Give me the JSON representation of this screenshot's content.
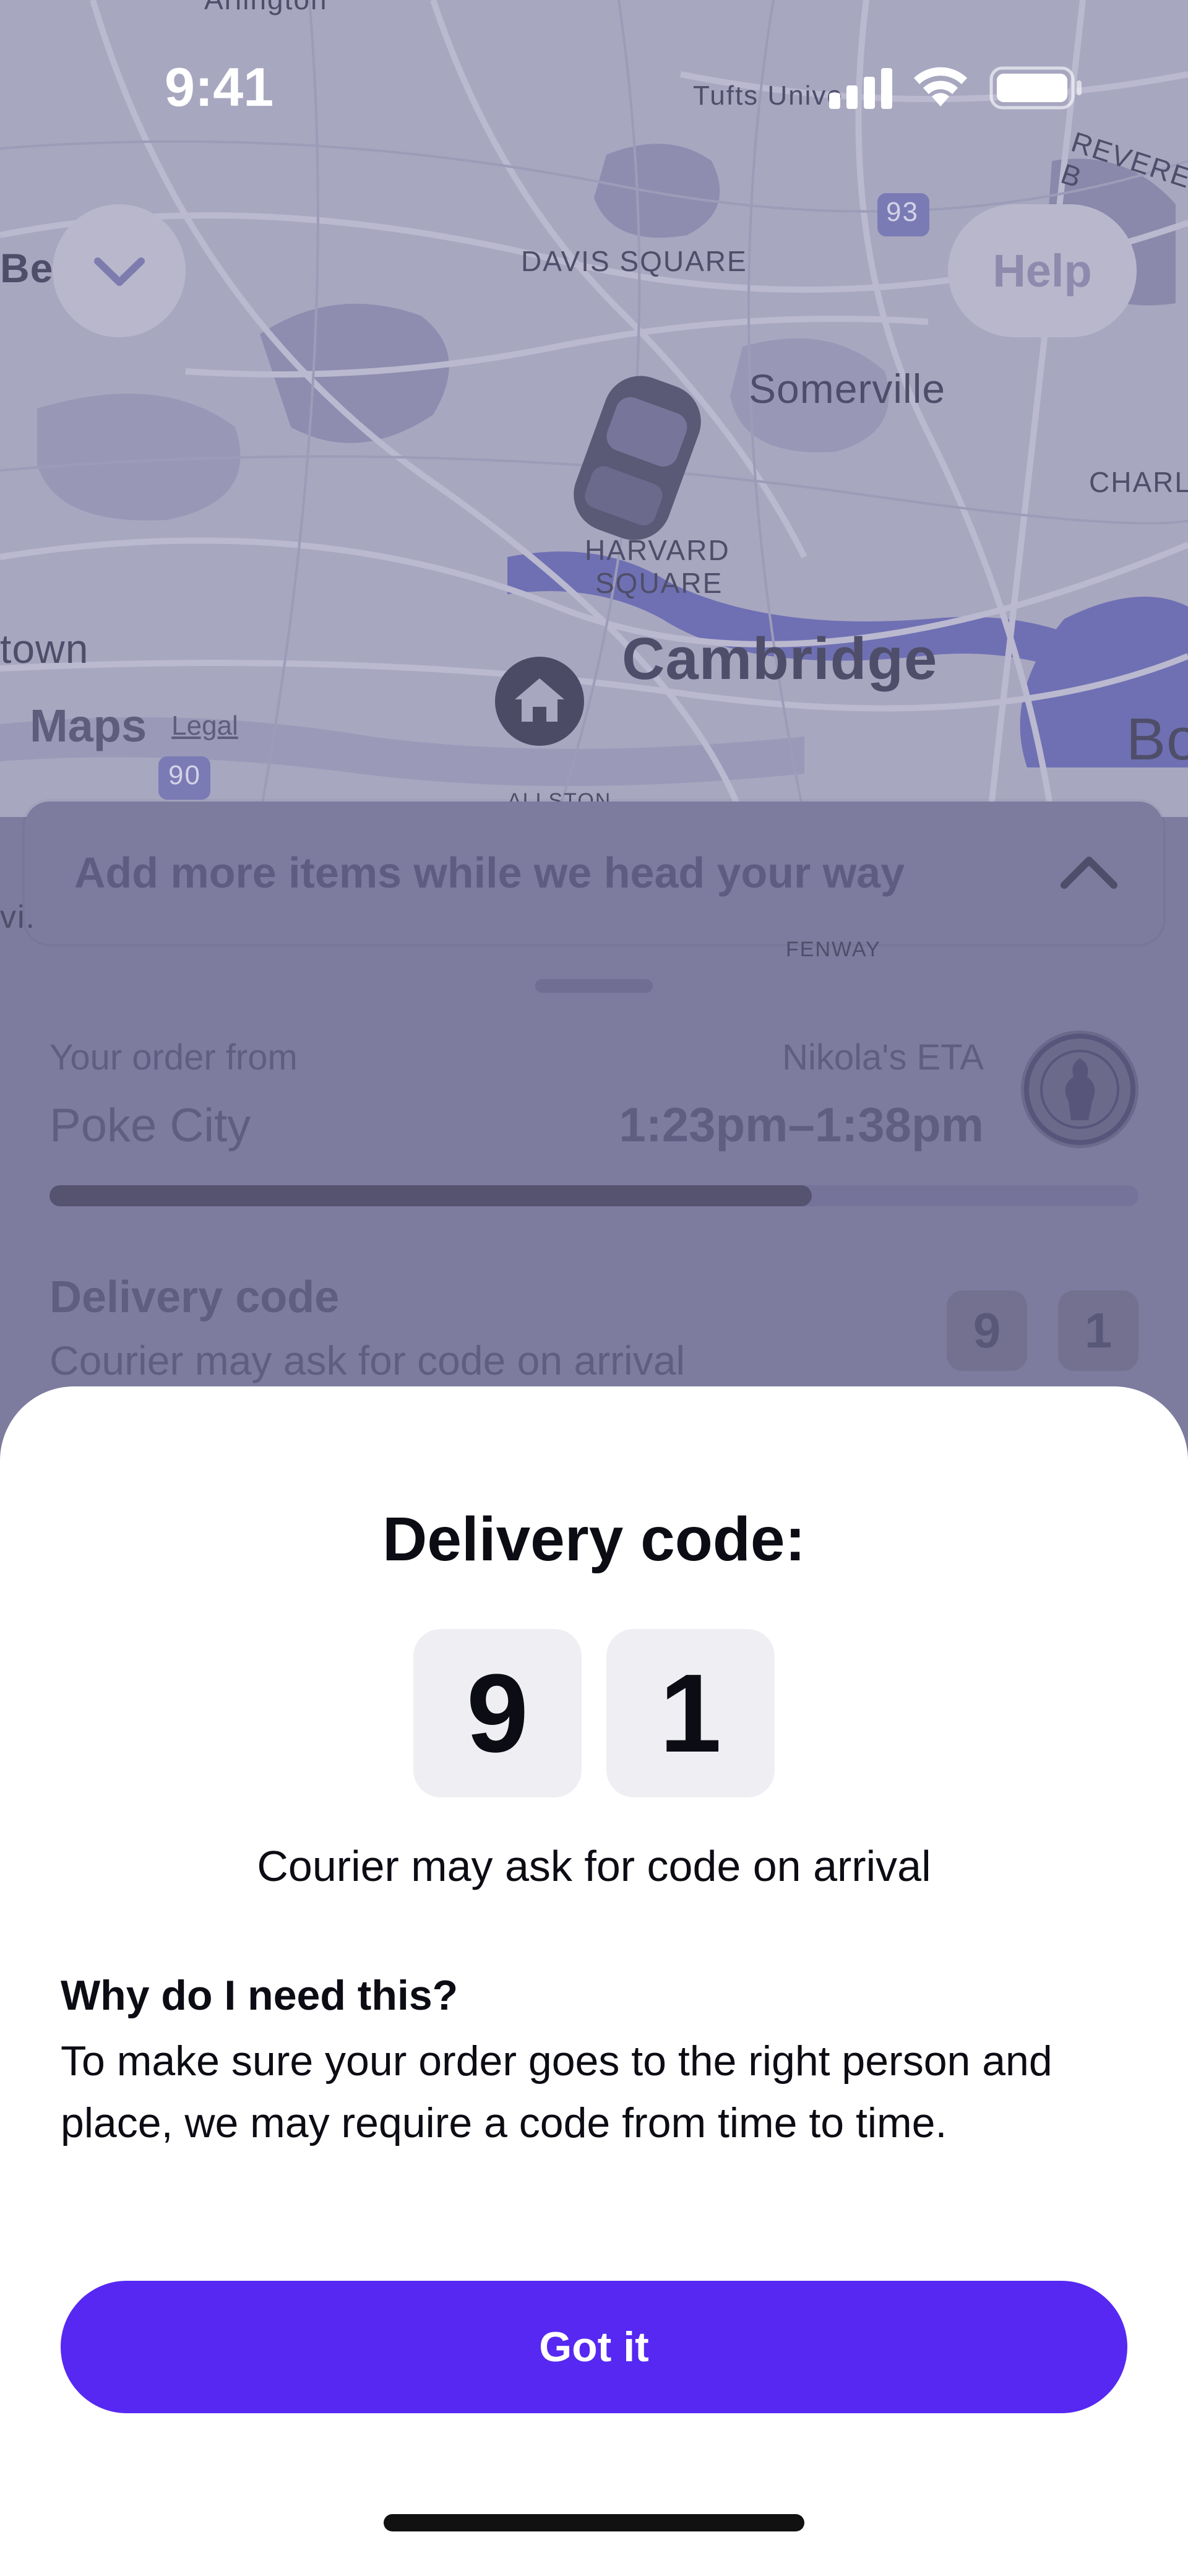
{
  "status_bar": {
    "time": "9:41"
  },
  "map": {
    "labels": {
      "arlington": "Arlington",
      "tufts": "Tufts Unive",
      "revere": "REVERE B",
      "be": "Be",
      "davis": "DAVIS SQUARE",
      "somerville": "Somerville",
      "charle": "CHARLE",
      "harvard1": "HARVARD",
      "harvard2": "SQUARE",
      "cambridge": "Cambridge",
      "town": "town",
      "boston": "Bo",
      "route93": "93",
      "route90": "90",
      "allston": "ALLSTON",
      "fenway": "FENWAY",
      "vi": "vi."
    },
    "attribution": {
      "brand": "Maps",
      "legal": "Legal"
    },
    "help_label": "Help"
  },
  "banner": {
    "text": "Add more items while we head your way"
  },
  "order": {
    "from_label": "Your order from",
    "restaurant": "Poke City",
    "eta_label": "Nikola's ETA",
    "eta_value": "1:23pm–1:38pm",
    "progress": 0.7,
    "delivery_code_label": "Delivery code",
    "delivery_code_sub": "Courier may ask for code on arrival",
    "code_digits": [
      "9",
      "1"
    ]
  },
  "modal": {
    "title": "Delivery code:",
    "digits": [
      "9",
      "1"
    ],
    "subtitle": "Courier may ask for code on arrival",
    "why_title": "Why do I need this?",
    "why_body": "To make sure your order goes to the right person and place, we may require a code from time to time.",
    "button_label": "Got it"
  },
  "colors": {
    "accent": "#5628f2",
    "overlay": "#7d7b9e",
    "code_box": "#efeff3"
  }
}
